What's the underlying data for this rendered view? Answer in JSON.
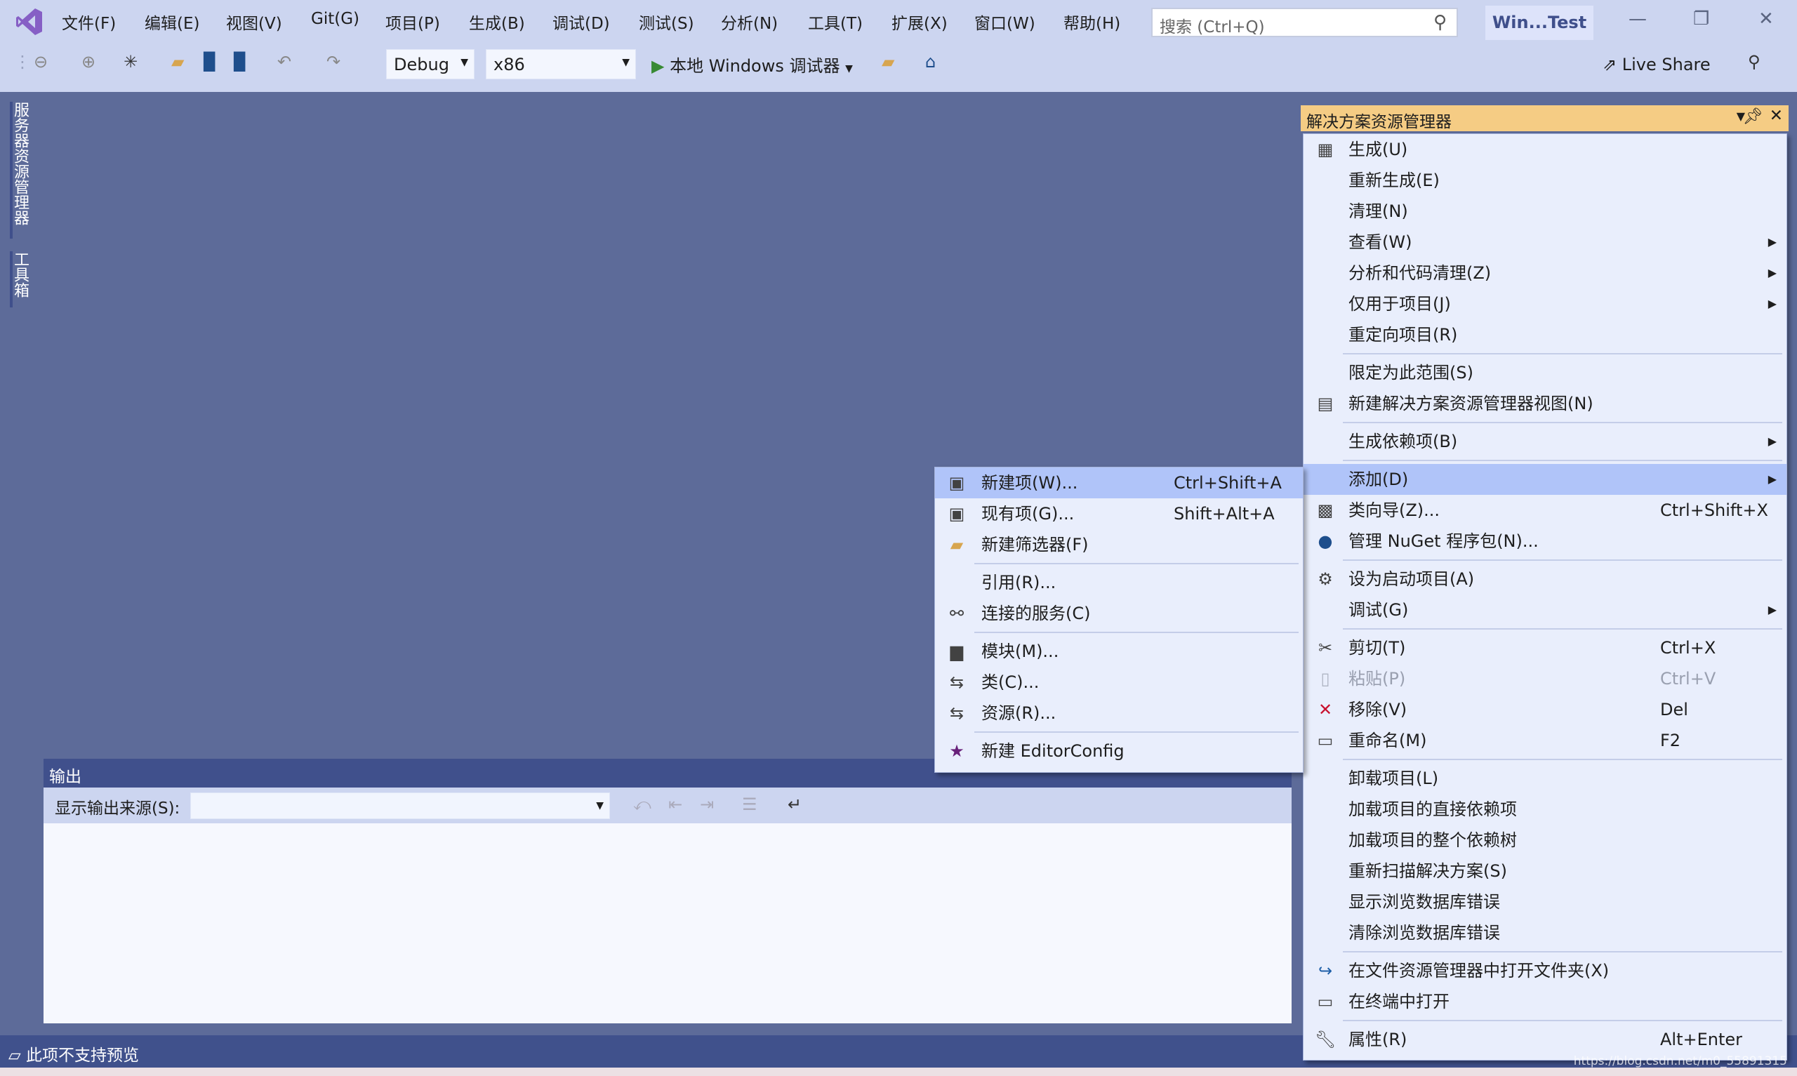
{
  "menubar": {
    "items": [
      "文件(F)",
      "编辑(E)",
      "视图(V)",
      "Git(G)",
      "项目(P)",
      "生成(B)",
      "调试(D)",
      "测试(S)",
      "分析(N)",
      "工具(T)",
      "扩展(X)",
      "窗口(W)",
      "帮助(H)"
    ],
    "search_placeholder": "搜索 (Ctrl+Q)",
    "window_title": "Win...Test"
  },
  "toolbar": {
    "config": "Debug",
    "platform": "x86",
    "run_label": "本地 Windows 调试器",
    "live_share": "Live Share"
  },
  "left_tabs": [
    "服务器资源管理器",
    "工具箱"
  ],
  "solution_explorer": {
    "title": "解决方案资源管理器"
  },
  "context_menu": {
    "groups": [
      [
        {
          "label": "生成(U)",
          "icon": "build-icon"
        },
        {
          "label": "重新生成(E)"
        },
        {
          "label": "清理(N)"
        },
        {
          "label": "查看(W)",
          "submenu": true
        },
        {
          "label": "分析和代码清理(Z)",
          "submenu": true
        },
        {
          "label": "仅用于项目(J)",
          "submenu": true
        },
        {
          "label": "重定向项目(R)"
        }
      ],
      [
        {
          "label": "限定为此范围(S)"
        },
        {
          "label": "新建解决方案资源管理器视图(N)",
          "icon": "new-view-icon"
        }
      ],
      [
        {
          "label": "生成依赖项(B)",
          "submenu": true
        }
      ],
      [
        {
          "label": "添加(D)",
          "submenu": true,
          "highlighted": true
        },
        {
          "label": "类向导(Z)...",
          "shortcut": "Ctrl+Shift+X",
          "icon": "class-wizard-icon"
        },
        {
          "label": "管理 NuGet 程序包(N)...",
          "icon": "nuget-icon"
        }
      ],
      [
        {
          "label": "设为启动项目(A)",
          "icon": "gear-icon"
        },
        {
          "label": "调试(G)",
          "submenu": true
        }
      ],
      [
        {
          "label": "剪切(T)",
          "shortcut": "Ctrl+X",
          "icon": "scissors-icon"
        },
        {
          "label": "粘贴(P)",
          "shortcut": "Ctrl+V",
          "icon": "paste-icon",
          "disabled": true
        },
        {
          "label": "移除(V)",
          "shortcut": "Del",
          "icon": "remove-icon"
        },
        {
          "label": "重命名(M)",
          "shortcut": "F2",
          "icon": "rename-icon"
        }
      ],
      [
        {
          "label": "卸载项目(L)"
        },
        {
          "label": "加载项目的直接依赖项"
        },
        {
          "label": "加载项目的整个依赖树"
        },
        {
          "label": "重新扫描解决方案(S)"
        },
        {
          "label": "显示浏览数据库错误"
        },
        {
          "label": "清除浏览数据库错误"
        }
      ],
      [
        {
          "label": "在文件资源管理器中打开文件夹(X)",
          "icon": "open-folder-icon"
        },
        {
          "label": "在终端中打开",
          "icon": "terminal-icon"
        }
      ],
      [
        {
          "label": "属性(R)",
          "shortcut": "Alt+Enter",
          "icon": "wrench-icon"
        }
      ]
    ]
  },
  "add_submenu": {
    "groups": [
      [
        {
          "label": "新建项(W)...",
          "shortcut": "Ctrl+Shift+A",
          "icon": "new-item-icon",
          "highlighted": true
        },
        {
          "label": "现有项(G)...",
          "shortcut": "Shift+Alt+A",
          "icon": "existing-item-icon"
        },
        {
          "label": "新建筛选器(F)",
          "icon": "new-filter-icon"
        }
      ],
      [
        {
          "label": "引用(R)..."
        },
        {
          "label": "连接的服务(C)",
          "icon": "connected-service-icon"
        }
      ],
      [
        {
          "label": "模块(M)...",
          "icon": "module-icon"
        },
        {
          "label": "类(C)...",
          "icon": "class-icon"
        },
        {
          "label": "资源(R)...",
          "icon": "resource-icon"
        }
      ],
      [
        {
          "label": "新建 EditorConfig",
          "icon": "editorconfig-icon"
        }
      ]
    ]
  },
  "output": {
    "title": "输出",
    "source_label": "显示输出来源(S):",
    "source_value": ""
  },
  "status": {
    "text": "此项不支持预览"
  },
  "watermark": "https://blog.csdn.net/m0_55891315",
  "colors": {
    "accent": "#68217a",
    "header_active": "#f5cc84",
    "highlight": "#b0c4f9",
    "status": "#40518c"
  }
}
